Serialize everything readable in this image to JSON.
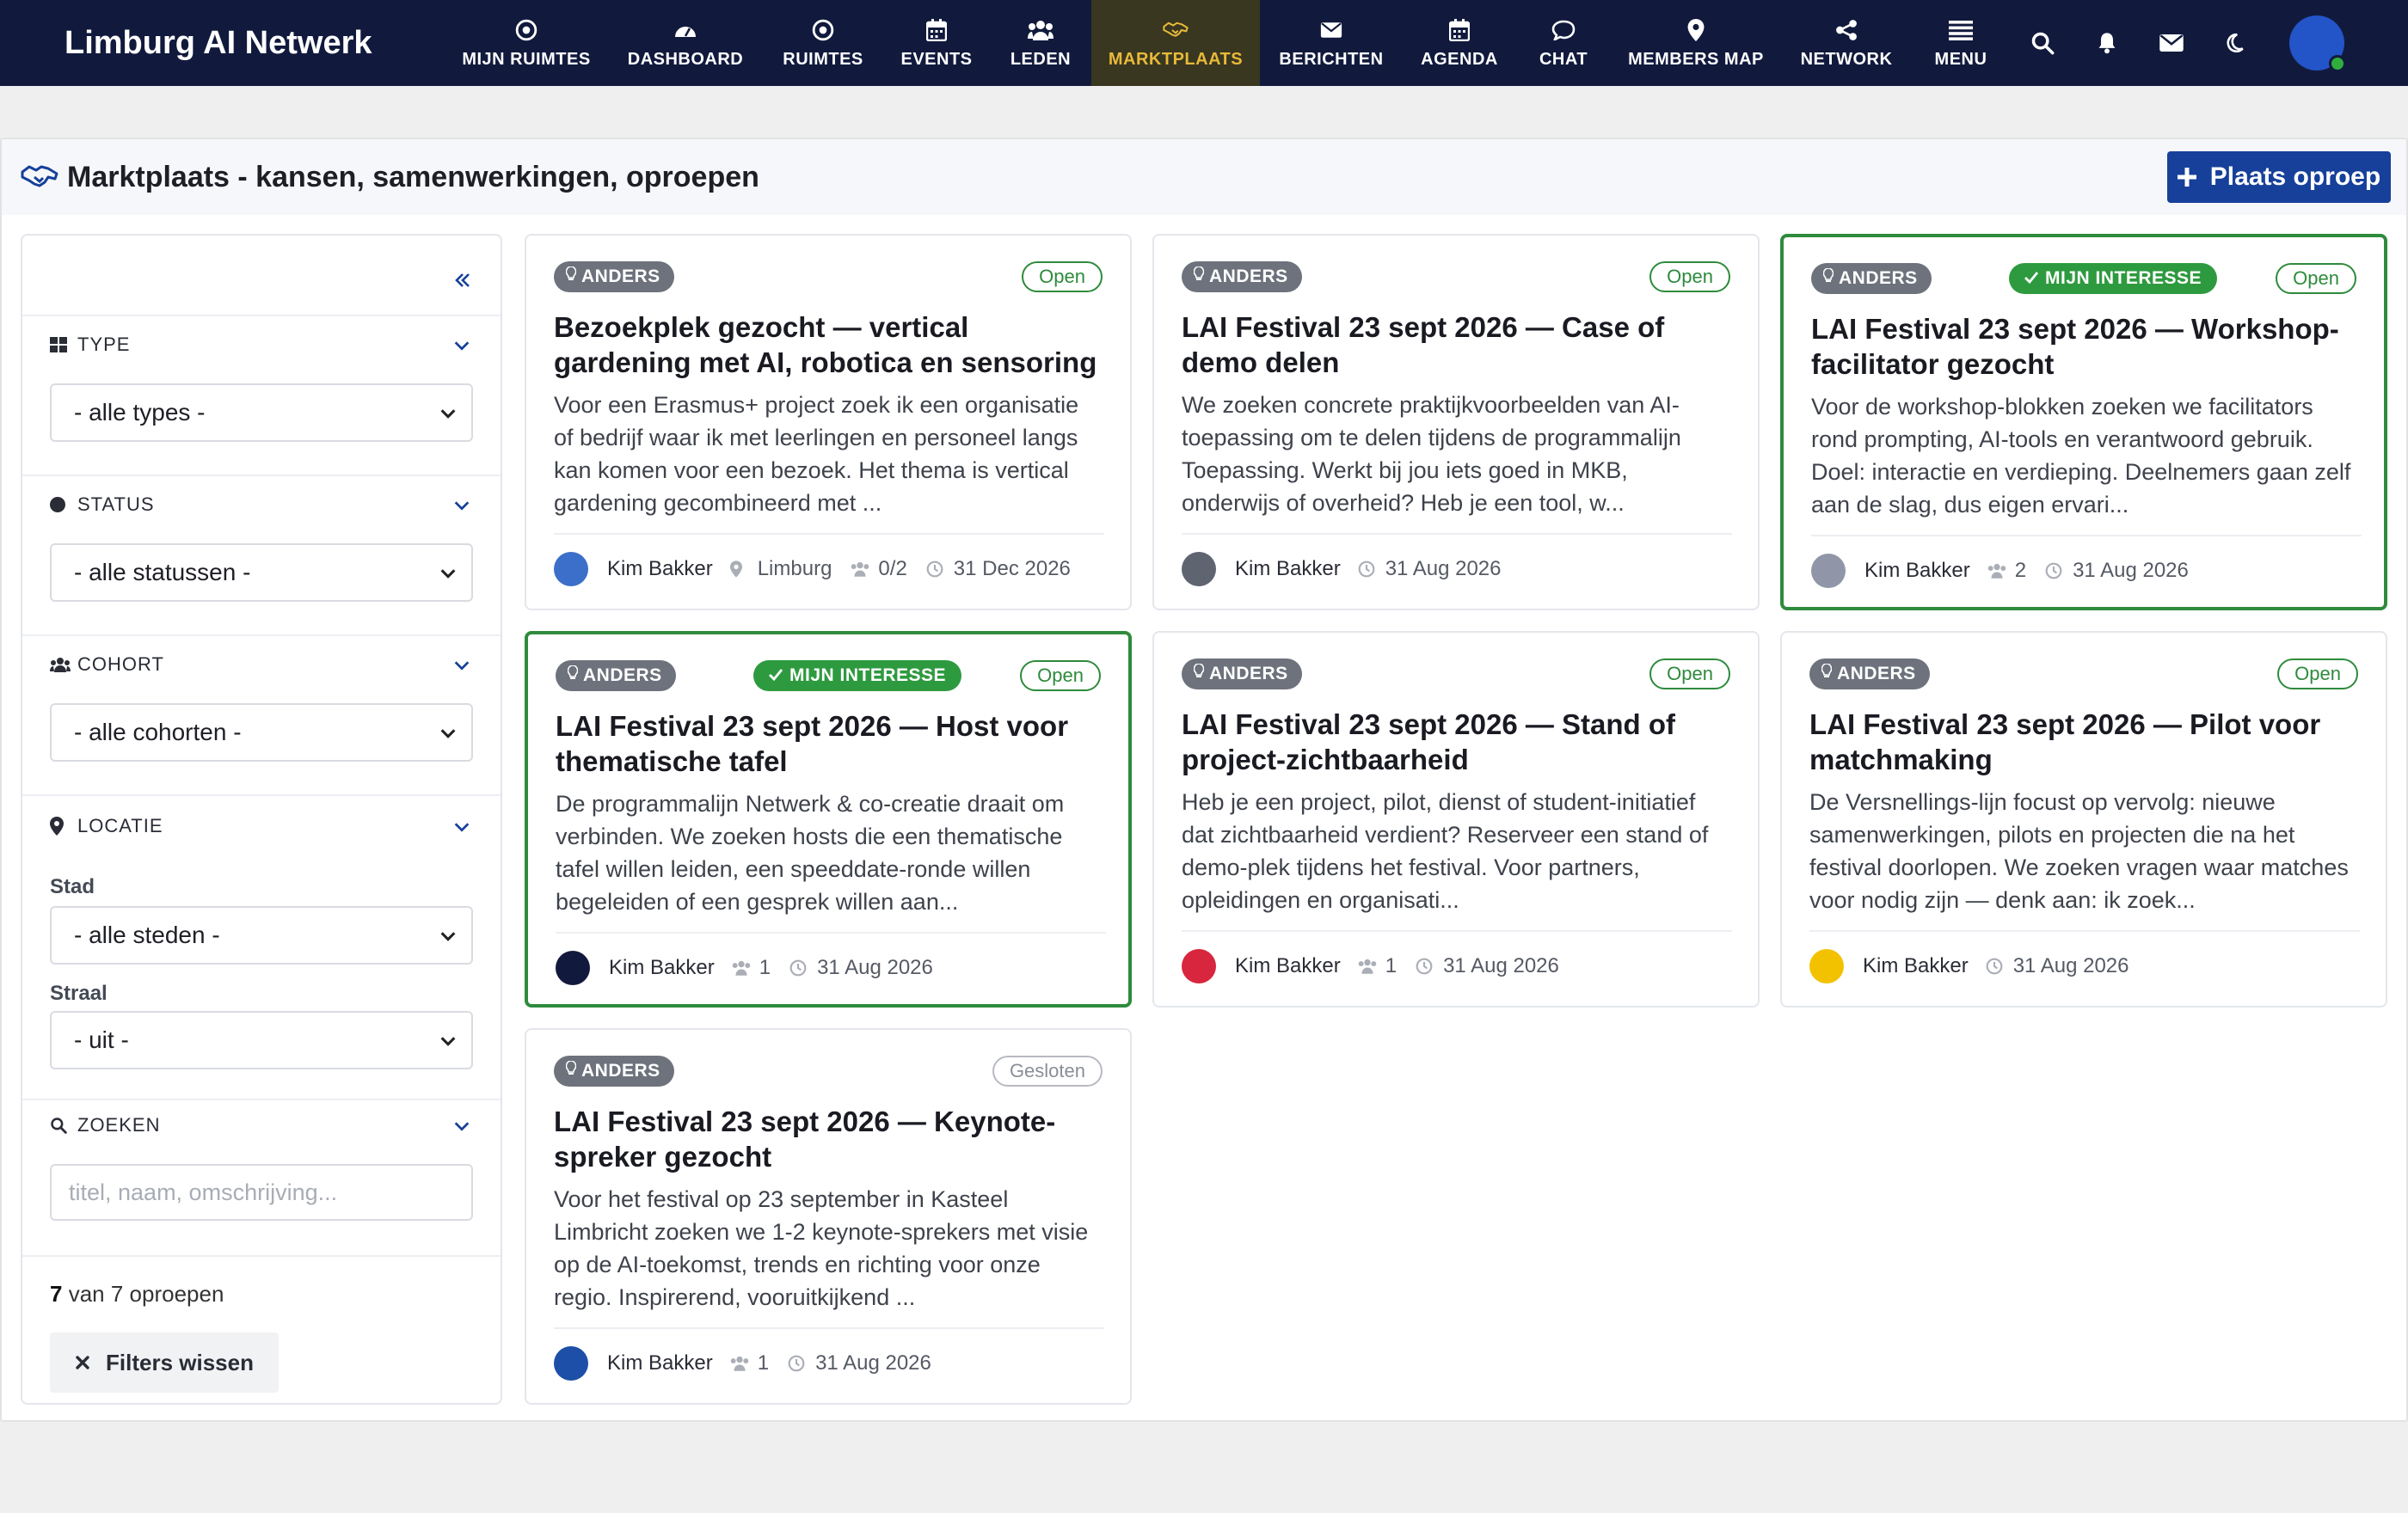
{
  "app": {
    "name": "Limburg AI Netwerk"
  },
  "nav": {
    "items": [
      {
        "label": "MIJN RUIMTES",
        "icon": "target-icon"
      },
      {
        "label": "DASHBOARD",
        "icon": "dashboard-icon"
      },
      {
        "label": "RUIMTES",
        "icon": "target-icon"
      },
      {
        "label": "EVENTS",
        "icon": "calendar-icon"
      },
      {
        "label": "LEDEN",
        "icon": "users-icon"
      },
      {
        "label": "MARKTPLAATS",
        "icon": "handshake-icon",
        "active": true
      },
      {
        "label": "BERICHTEN",
        "icon": "envelope-icon"
      },
      {
        "label": "AGENDA",
        "icon": "calendar-icon"
      },
      {
        "label": "CHAT",
        "icon": "chat-icon"
      },
      {
        "label": "MEMBERS MAP",
        "icon": "map-pin-icon"
      },
      {
        "label": "NETWORK",
        "icon": "share-icon"
      },
      {
        "label": "MENU",
        "icon": "menu-icon"
      }
    ],
    "right_icons": [
      "search-icon",
      "bell-icon",
      "envelope-icon",
      "moon-icon"
    ]
  },
  "page": {
    "title": "Marktplaats - kansen, samenwerkingen, oproepen",
    "primary_button": "Plaats oproep"
  },
  "sidebar": {
    "type": {
      "label": "TYPE",
      "value": "- alle types -"
    },
    "status": {
      "label": "STATUS",
      "value": "- alle statussen -"
    },
    "cohort": {
      "label": "COHORT",
      "value": "- alle cohorten -"
    },
    "locatie": {
      "label": "LOCATIE",
      "stad_label": "Stad",
      "stad_value": "- alle steden -",
      "straal_label": "Straal",
      "straal_value": "- uit -"
    },
    "zoeken": {
      "label": "ZOEKEN",
      "placeholder": "titel, naam, omschrijving..."
    },
    "count_shown": "7",
    "count_rest": "van 7 oproepen",
    "clear_button": "Filters wissen"
  },
  "colors": {
    "nav_bg": "#111a3d",
    "nav_active_text": "#e8b93a",
    "primary": "#16409a",
    "open_green": "#2e8b3c"
  },
  "cards": [
    {
      "category": "ANDERS",
      "status": "Open",
      "interest": "",
      "title": "Bezoekplek gezocht — vertical gardening met AI, robotica en sensoring",
      "desc": "Voor een Erasmus+ project zoek ik een organisatie of bedrijf waar ik met leerlingen en personeel langs kan komen voor een bezoek. Het thema is vertical gardening gecombineerd met ...",
      "author": "Kim Bakker",
      "avatar_color": "#3b6fc9",
      "location": "Limburg",
      "participants": "0/2",
      "date": "31 Dec 2026"
    },
    {
      "category": "ANDERS",
      "status": "Open",
      "interest": "",
      "title": "LAI Festival 23 sept 2026 — Case of demo delen",
      "desc": "We zoeken concrete praktijkvoorbeelden van AI-toepassing om te delen tijdens de programmalijn Toepassing. Werkt bij jou iets goed in MKB, onderwijs of overheid? Heb je een tool, w...",
      "author": "Kim Bakker",
      "avatar_color": "#5e6570",
      "location": "",
      "participants": "",
      "date": "31 Aug 2026"
    },
    {
      "category": "ANDERS",
      "status": "Open",
      "interest": "MIJN INTERESSE",
      "title": "LAI Festival 23 sept 2026 — Workshop-facilitator gezocht",
      "desc": "Voor de workshop-blokken zoeken we facilitators rond prompting, AI-tools en verantwoord gebruik. Doel: interactie en verdieping. Deelnemers gaan zelf aan de slag, dus eigen ervari...",
      "author": "Kim Bakker",
      "avatar_color": "#9096a8",
      "location": "",
      "participants": "2",
      "date": "31 Aug 2026"
    },
    {
      "category": "ANDERS",
      "status": "Open",
      "interest": "MIJN INTERESSE",
      "title": "LAI Festival 23 sept 2026 — Host voor thematische tafel",
      "desc": "De programmalijn Netwerk & co-creatie draait om verbinden. We zoeken hosts die een thematische tafel willen leiden, een speeddate-ronde willen begeleiden of een gesprek willen aan...",
      "author": "Kim Bakker",
      "avatar_color": "#111a3d",
      "location": "",
      "participants": "1",
      "date": "31 Aug 2026"
    },
    {
      "category": "ANDERS",
      "status": "Open",
      "interest": "",
      "title": "LAI Festival 23 sept 2026 — Stand of project-zichtbaarheid",
      "desc": "Heb je een project, pilot, dienst of student-initiatief dat zichtbaarheid verdient? Reserveer een stand of demo-plek tijdens het festival. Voor partners, opleidingen en organisati...",
      "author": "Kim Bakker",
      "avatar_color": "#d7263d",
      "location": "",
      "participants": "1",
      "date": "31 Aug 2026"
    },
    {
      "category": "ANDERS",
      "status": "Open",
      "interest": "",
      "title": "LAI Festival 23 sept 2026 — Pilot voor matchmaking",
      "desc": "De Versnellings-lijn focust op vervolg: nieuwe samenwerkingen, pilots en projecten die na het festival doorlopen. We zoeken vragen waar matches voor nodig zijn — denk aan: ik zoek...",
      "author": "Kim Bakker",
      "avatar_color": "#f2c200",
      "location": "",
      "participants": "",
      "date": "31 Aug 2026"
    },
    {
      "category": "ANDERS",
      "status": "Gesloten",
      "interest": "",
      "title": "LAI Festival 23 sept 2026 — Keynote-spreker gezocht",
      "desc": "Voor het festival op 23 september in Kasteel Limbricht zoeken we 1-2 keynote-sprekers met visie op de AI-toekomst, trends en richting voor onze regio. Inspirerend, vooruitkijkend ...",
      "author": "Kim Bakker",
      "avatar_color": "#1d4fa8",
      "location": "",
      "participants": "1",
      "date": "31 Aug 2026"
    }
  ]
}
